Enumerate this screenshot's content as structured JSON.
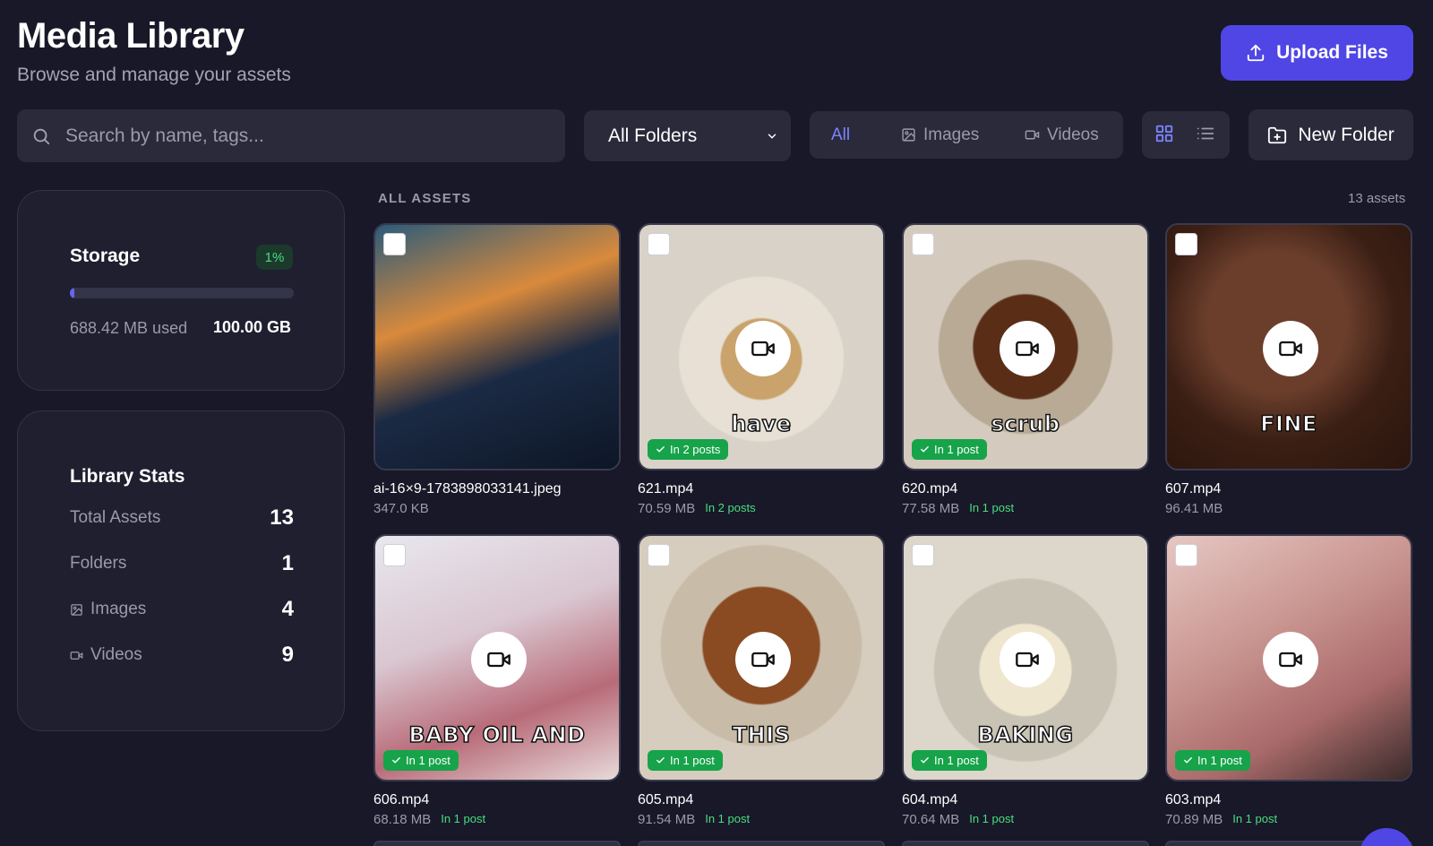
{
  "header": {
    "title": "Media Library",
    "subtitle": "Browse and manage your assets",
    "upload_label": "Upload Files"
  },
  "toolbar": {
    "search_placeholder": "Search by name, tags...",
    "folder_selected": "All Folders",
    "filters": [
      {
        "label": "All",
        "icon": "none",
        "active": true
      },
      {
        "label": "Images",
        "icon": "image-icon",
        "active": false
      },
      {
        "label": "Videos",
        "icon": "video-icon",
        "active": false
      }
    ],
    "view_modes": [
      "grid-view-icon",
      "list-view-icon"
    ],
    "active_view": "grid",
    "new_folder_label": "New Folder"
  },
  "storage": {
    "title": "Storage",
    "percent_label": "1%",
    "used_fraction": 0.007,
    "used_label": "688.42 MB used",
    "total_label": "100.00 GB"
  },
  "stats": {
    "title": "Library Stats",
    "rows": [
      {
        "label": "Total Assets",
        "value": "13",
        "icon": "none"
      },
      {
        "label": "Folders",
        "value": "1",
        "icon": "none"
      },
      {
        "label": "Images",
        "value": "4",
        "icon": "image-icon"
      },
      {
        "label": "Videos",
        "value": "9",
        "icon": "video-icon"
      }
    ]
  },
  "assets_section": {
    "label": "ALL ASSETS",
    "count_label": "13 assets"
  },
  "assets": [
    {
      "name": "ai-16×9-1783898033141.jpeg",
      "size": "347.0 KB",
      "posts": "",
      "type": "image",
      "caption": "",
      "badge": ""
    },
    {
      "name": "621.mp4",
      "size": "70.59 MB",
      "posts": "In 2 posts",
      "type": "video",
      "caption": "have",
      "badge": "In 2 posts"
    },
    {
      "name": "620.mp4",
      "size": "77.58 MB",
      "posts": "In 1 post",
      "type": "video",
      "caption": "scrub",
      "badge": "In 1 post"
    },
    {
      "name": "607.mp4",
      "size": "96.41 MB",
      "posts": "",
      "type": "video",
      "caption": "FINE",
      "badge": ""
    },
    {
      "name": "606.mp4",
      "size": "68.18 MB",
      "posts": "In 1 post",
      "type": "video",
      "caption": "BABY OIL AND",
      "badge": "In 1 post"
    },
    {
      "name": "605.mp4",
      "size": "91.54 MB",
      "posts": "In 1 post",
      "type": "video",
      "caption": "THIS",
      "badge": "In 1 post"
    },
    {
      "name": "604.mp4",
      "size": "70.64 MB",
      "posts": "In 1 post",
      "type": "video",
      "caption": "BAKING",
      "badge": "In 1 post"
    },
    {
      "name": "603.mp4",
      "size": "70.89 MB",
      "posts": "In 1 post",
      "type": "video",
      "caption": "",
      "badge": "In 1 post"
    }
  ],
  "colors": {
    "background": "#181828",
    "accent": "#4f46e5",
    "success": "#16a34a"
  }
}
